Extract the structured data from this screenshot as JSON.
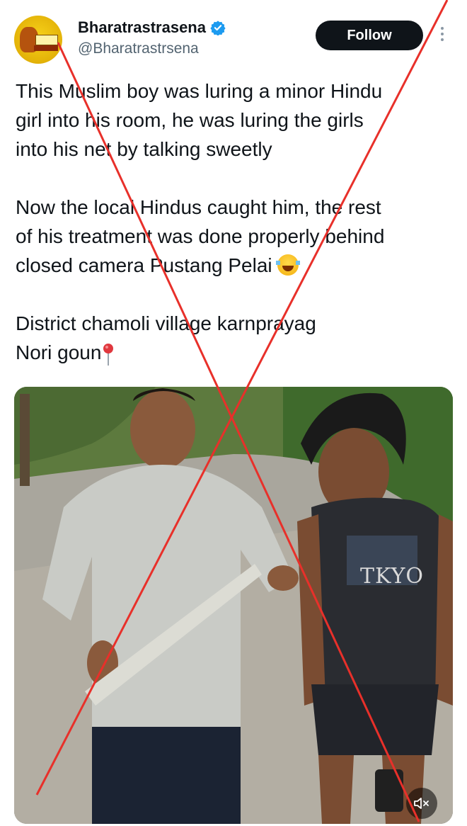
{
  "author": {
    "display_name": "Bharatrastrasena",
    "handle": "@Bharatrastrsena",
    "verified": true,
    "avatar_icon": "avatar-logo-icon"
  },
  "follow_label": "Follow",
  "more_icon": "more-vertical-icon",
  "tweet": {
    "paragraph_1": [
      "This Muslim boy was luring a minor Hindu",
      "girl into his room, he was luring the girls",
      "into his net by talking sweetly"
    ],
    "paragraph_2": [
      "Now the local Hindus caught him, the rest",
      "of his treatment was done properly behind",
      "closed camera Pustang Pelai"
    ],
    "paragraph_2_emoji": "laughing-tears-emoji",
    "paragraph_3": [
      "District chamoli village karnprayag",
      "Nori goun"
    ],
    "paragraph_3_emoji": "round-pushpin-emoji"
  },
  "media": {
    "shirt_text": "TKYO",
    "mute_icon": "speaker-muted-icon"
  },
  "overlay": {
    "type": "red-cross-out",
    "color": "#e8302a"
  },
  "colors": {
    "text": "#0f1419",
    "secondary": "#536471",
    "verified": "#1d9bf0",
    "button": "#0f1419"
  }
}
